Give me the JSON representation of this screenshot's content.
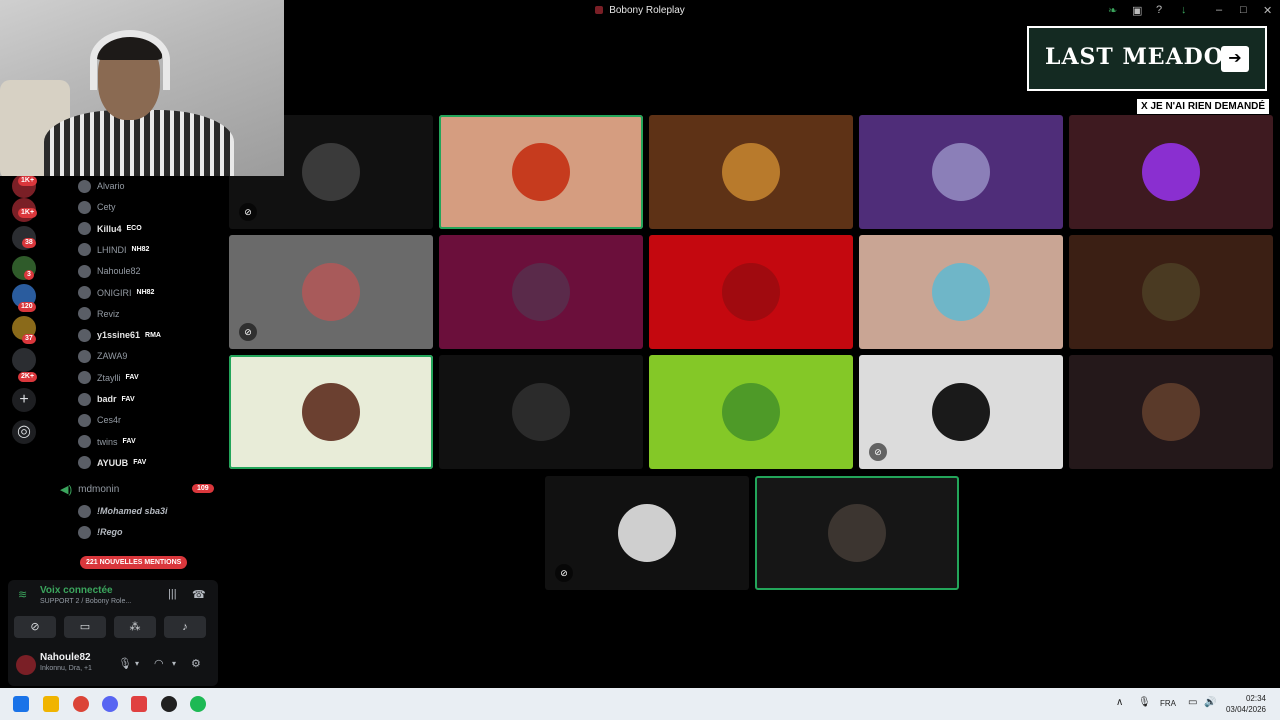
{
  "window": {
    "title": "Bobony Roleplay"
  },
  "servers": {
    "badges": [
      "1K+",
      "1K+",
      "38",
      "3",
      "120",
      "37",
      "2K+"
    ],
    "add_icon": "plus-icon",
    "discover_icon": "compass-icon"
  },
  "members": [
    {
      "name": "Alvario",
      "tag": "",
      "bright": false
    },
    {
      "name": "Cety",
      "tag": "",
      "bright": false
    },
    {
      "name": "Killu4",
      "tag": "ECO",
      "bright": true
    },
    {
      "name": "LHINDI",
      "tag": "NH82",
      "bright": false
    },
    {
      "name": "Nahoule82",
      "tag": "",
      "bright": false
    },
    {
      "name": "ONIGIRI",
      "tag": "NH82",
      "bright": false
    },
    {
      "name": "Reviz",
      "tag": "",
      "bright": false
    },
    {
      "name": "y1ssine61",
      "tag": "RMA",
      "bright": true
    },
    {
      "name": "ZAWA9",
      "tag": "",
      "bright": false
    },
    {
      "name": "Ztaylli",
      "tag": "FAV",
      "bright": false
    },
    {
      "name": "badr",
      "tag": "FAV",
      "bright": true
    },
    {
      "name": "Ces4r",
      "tag": "",
      "bright": false
    },
    {
      "name": "twins",
      "tag": "FAV",
      "bright": false
    },
    {
      "name": "AYUUB",
      "tag": "FAV",
      "bright": true
    }
  ],
  "voice_channel": {
    "name": "mdmonin",
    "count": "109"
  },
  "sub_members": [
    "!Mohamed sba3i",
    "!Rego"
  ],
  "mentions": "221 NOUVELLES MENTIONS",
  "voice_panel": {
    "status": "Voix connectée",
    "channel": "SUPPORT 2 / Bobony Role..."
  },
  "user": {
    "name": "Nahoule82",
    "status": "Inkonnu, Dra, +1"
  },
  "banner": {
    "title": "LAST MEADOW",
    "tag": "X JE N'AI RIEN DEMANDÉ"
  },
  "tiles": [
    {
      "bg": "#111111",
      "avatar": "#3a3a3a",
      "muted": true,
      "speaking": false
    },
    {
      "bg": "#d59d80",
      "avatar": "#c63b1e",
      "muted": false,
      "speaking": true
    },
    {
      "bg": "#5e3216",
      "avatar": "#b87a2c",
      "muted": false,
      "speaking": false
    },
    {
      "bg": "#4f2d79",
      "avatar": "#8b7fb8",
      "muted": false,
      "speaking": false
    },
    {
      "bg": "#3e1a20",
      "avatar": "#8a2fd0",
      "muted": false,
      "speaking": false
    },
    {
      "bg": "#6a6a6a",
      "avatar": "#a85a5a",
      "muted": true,
      "speaking": false
    },
    {
      "bg": "#6b0f3b",
      "avatar": "#5a2a4a",
      "muted": false,
      "speaking": false
    },
    {
      "bg": "#c4080f",
      "avatar": "#a00a0f",
      "muted": false,
      "speaking": false
    },
    {
      "bg": "#c9a594",
      "avatar": "#6fb6c8",
      "muted": false,
      "speaking": false
    },
    {
      "bg": "#3b1f14",
      "avatar": "#4a3a22",
      "muted": false,
      "speaking": false
    },
    {
      "bg": "#e8ecd8",
      "avatar": "#6b4030",
      "muted": false,
      "speaking": true
    },
    {
      "bg": "#111111",
      "avatar": "#2b2b2b",
      "muted": false,
      "speaking": false
    },
    {
      "bg": "#84c827",
      "avatar": "#4e9a28",
      "muted": false,
      "speaking": false
    },
    {
      "bg": "#dcdcdc",
      "avatar": "#1a1a1a",
      "muted": true,
      "speaking": false
    },
    {
      "bg": "#24181a",
      "avatar": "#5a3a2a",
      "muted": false,
      "speaking": false
    },
    {
      "bg": "#111111",
      "avatar": "#cfcfcf",
      "muted": true,
      "speaking": false
    },
    {
      "bg": "#161616",
      "avatar": "#3c3530",
      "muted": false,
      "speaking": true
    }
  ],
  "taskbar": {
    "lang": "FRA",
    "time": "02:34",
    "date": "03/04/2026"
  }
}
